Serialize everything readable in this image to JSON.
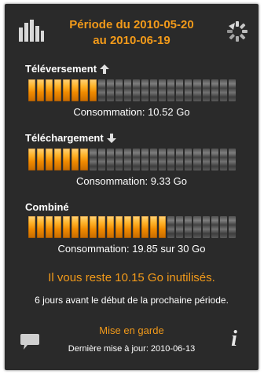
{
  "header": {
    "period_line1": "Période du 2010-05-20",
    "period_line2": "au 2010-06-19",
    "left_icon": "bar-chart-icon",
    "right_icon": "refresh-icon"
  },
  "upload": {
    "title": "Téléversement",
    "arrow_icon": "arrow-up-icon",
    "filled_fraction": 0.35,
    "usage_text": "Consommation: 10.52 Go"
  },
  "download": {
    "title": "Téléchargement",
    "arrow_icon": "arrow-down-icon",
    "filled_fraction": 0.31,
    "usage_text": "Consommation: 9.33 Go"
  },
  "combined": {
    "title": "Combiné",
    "filled_fraction": 0.66,
    "usage_text": "Consommation: 19.85 sur 30 Go"
  },
  "remaining_text": "Il vous reste 10.15 Go inutilisés.",
  "days_text": "6 jours avant le début de la prochaine période.",
  "footer": {
    "standby_label": "Mise en garde",
    "updated_text": "Dernière mise à jour: 2010-06-13",
    "chat_icon": "speech-bubble-icon",
    "info_icon": "info-icon",
    "info_glyph": "i"
  },
  "colors": {
    "accent": "#f29a1a",
    "background": "#2a2a2a"
  }
}
